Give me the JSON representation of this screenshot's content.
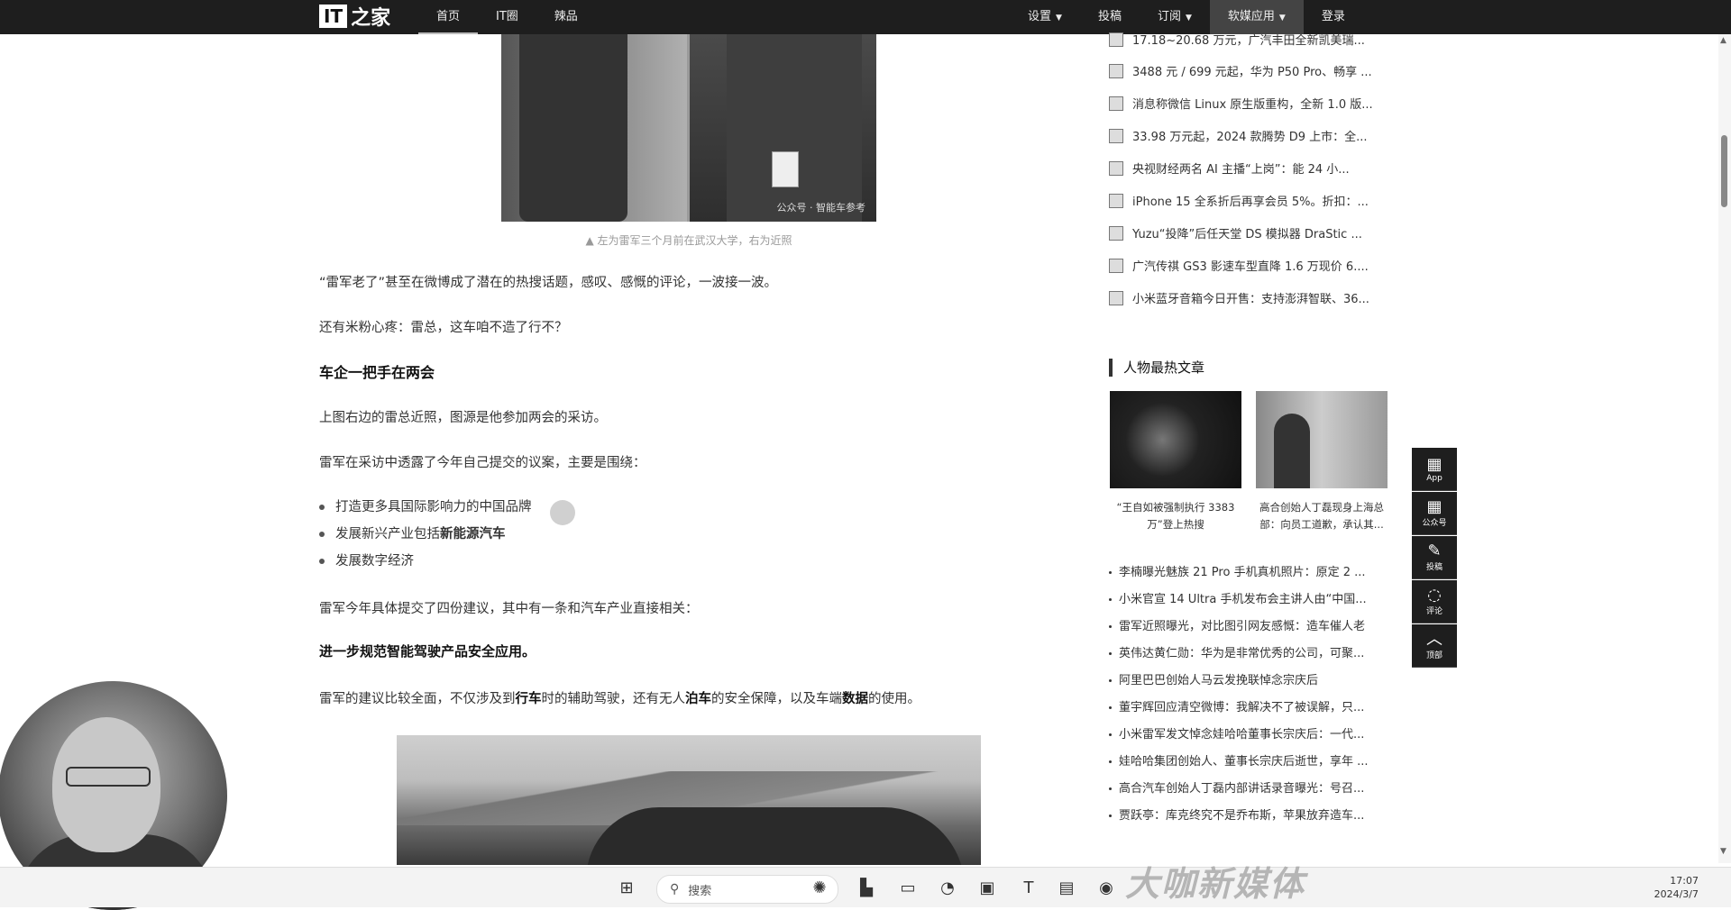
{
  "header": {
    "logo_it": "IT",
    "logo_cn": "之家",
    "nav_left": [
      "首页",
      "IT圈",
      "辣品"
    ],
    "nav_right": {
      "settings": "设置",
      "submit": "投稿",
      "subscribe": "订阅",
      "apps": "软媒应用",
      "login": "登录"
    }
  },
  "article": {
    "photo_watermark": "公众号 · 智能车参考",
    "caption": "▲ 左为雷军三个月前在武汉大学，右为近照",
    "p1": "“雷军老了”甚至在微博成了潜在的热搜话题，感叹、感慨的评论，一波接一波。",
    "p2": "还有米粉心疼：雷总，这车咱不造了行不？",
    "h_section": "车企一把手在两会",
    "p3": "上图右边的雷总近照，图源是他参加两会的采访。",
    "p4": "雷军在采访中透露了今年自己提交的议案，主要是围绕：",
    "bullets": [
      {
        "pre": "打造更多具国际影响力的中国品牌",
        "bold": ""
      },
      {
        "pre": "发展新兴产业包括",
        "bold": "新能源汽车"
      },
      {
        "pre": "发展数字经济",
        "bold": ""
      }
    ],
    "p5": "雷军今年具体提交了四份建议，其中有一条和汽车产业直接相关：",
    "h_bold": "进一步规范智能驾驶产品安全应用。",
    "p6": {
      "a": "雷军的建议比较全面，不仅涉及到",
      "b1": "行车",
      "c": "时的辅助驾驶，还有无人",
      "b2": "泊车",
      "d": "的安全保障，以及车端",
      "b3": "数据",
      "e": "的使用。"
    }
  },
  "sidebar": {
    "news": [
      "17.18~20.68 万元，广汽丰田全新凯美瑞...",
      "3488 元 / 699 元起，华为 P50 Pro、畅享 ...",
      "消息称微信 Linux 原生版重构，全新 1.0 版...",
      "33.98 万元起，2024 款腾势 D9 上市：全...",
      "央视财经两名 AI 主播“上岗”：能 24 小...",
      "iPhone 15 全系折后再享会员 5%。折扣：...",
      "Yuzu“投降”后任天堂 DS 模拟器 DraStic ...",
      "广汽传祺 GS3 影速车型直降 1.6 万现价 6....",
      "小米蓝牙音箱今日开售：支持澎湃智联、36..."
    ],
    "people_title": "人物最热文章",
    "thumb_a_caption": "“王自如被强制执行 3383 万”登上热搜",
    "thumb_b_caption": "高合创始人丁磊现身上海总部：向员工道歉，承认其...",
    "hot_list": [
      "李楠曝光魅族 21 Pro 手机真机照片：原定 2 ...",
      "小米官宣 14 Ultra 手机发布会主讲人由“中国...",
      "雷军近照曝光，对比图引网友感慨：造车催人老",
      "英伟达黄仁勋：华为是非常优秀的公司，可聚...",
      "阿里巴巴创始人马云发挽联悼念宗庆后",
      "董宇辉回应清空微博：我解决不了被误解，只...",
      "小米雷军发文悼念娃哈哈董事长宗庆后：一代...",
      "娃哈哈集团创始人、董事长宗庆后逝世，享年 ...",
      "高合汽车创始人丁磊内部讲话录音曝光：号召...",
      "贾跃亭：库克终究不是乔布斯，苹果放弃造车..."
    ]
  },
  "float_toolbar": {
    "app": "App",
    "wechat": "公众号",
    "submit": "投稿",
    "comment": "评论",
    "top": "顶部"
  },
  "taskbar": {
    "search": "搜索",
    "time": "17:07",
    "date": "2024/3/7"
  },
  "watermark": "大咖新媒体"
}
